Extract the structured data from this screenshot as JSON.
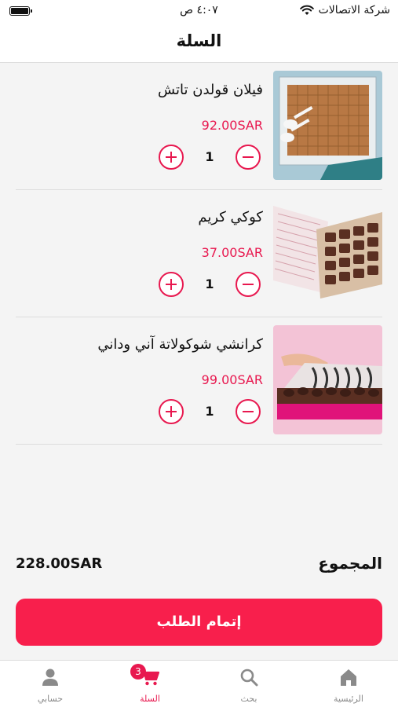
{
  "status_bar": {
    "carrier": "شركة الاتصالات",
    "time": "٤:٠٧ ص"
  },
  "header": {
    "title": "السلة"
  },
  "cart": {
    "items": [
      {
        "name": "فيلان قولدن تاتش",
        "price": "92.00SAR",
        "quantity": "1"
      },
      {
        "name": "كوكي كريم",
        "price": "37.00SAR",
        "quantity": "1"
      },
      {
        "name": "كرانشي شوكولاتة آني وداني",
        "price": "99.00SAR",
        "quantity": "1"
      }
    ]
  },
  "total": {
    "label": "المجموع",
    "value": "228.00SAR"
  },
  "checkout": {
    "label": "إتمام الطلب"
  },
  "tabs": {
    "home": {
      "label": "الرئيسية",
      "icon": "home-icon"
    },
    "search": {
      "label": "بحث",
      "icon": "search-icon"
    },
    "cart": {
      "label": "السلة",
      "icon": "cart-icon",
      "badge": "3"
    },
    "account": {
      "label": "حسابي",
      "icon": "user-icon"
    }
  },
  "colors": {
    "accent": "#f81f4c",
    "price": "#e8184f",
    "background": "#f4f4f4"
  }
}
